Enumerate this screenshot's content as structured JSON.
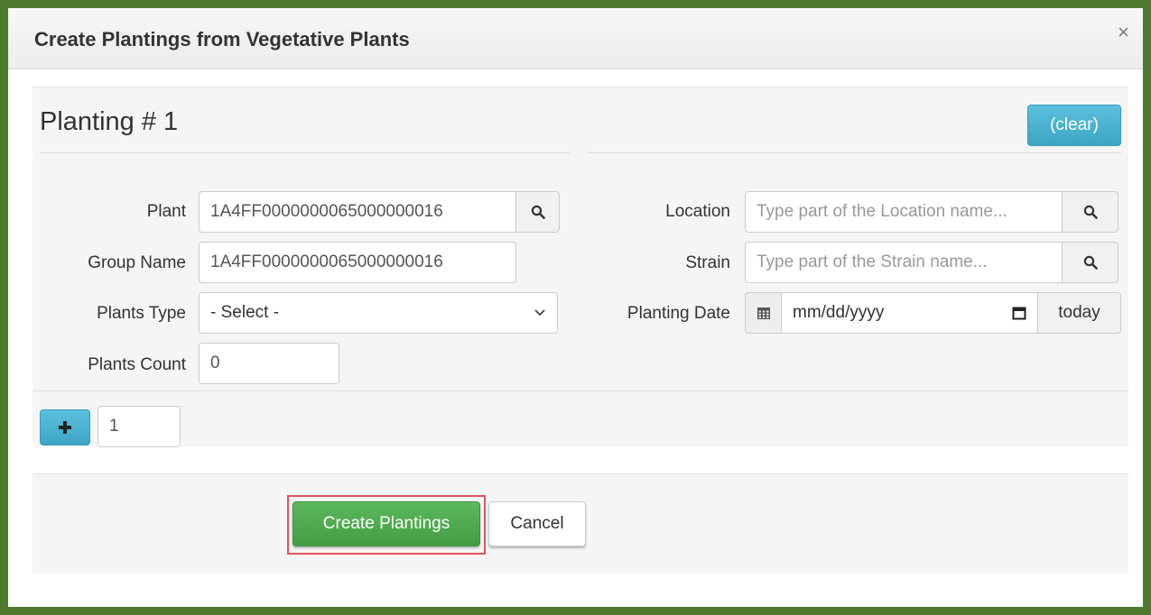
{
  "modal": {
    "title": "Create Plantings from Vegetative Plants",
    "close_label": "×"
  },
  "planting": {
    "heading": "Planting # 1",
    "clear_label": "(clear)"
  },
  "form": {
    "plant": {
      "label": "Plant",
      "value": "1A4FF0000000065000000016"
    },
    "group_name": {
      "label": "Group Name",
      "value": "1A4FF0000000065000000016"
    },
    "plants_type": {
      "label": "Plants Type",
      "selected": "- Select -"
    },
    "plants_count": {
      "label": "Plants Count",
      "value": "0"
    },
    "location": {
      "label": "Location",
      "placeholder": "Type part of the Location name..."
    },
    "strain": {
      "label": "Strain",
      "placeholder": "Type part of the Strain name..."
    },
    "planting_date": {
      "label": "Planting Date",
      "placeholder": "mm/dd/yyyy",
      "today_label": "today"
    }
  },
  "add_row": {
    "count": "1"
  },
  "actions": {
    "create_label": "Create Plantings",
    "cancel_label": "Cancel"
  },
  "icons": {
    "search": "search-icon",
    "calendar": "calendar-icon",
    "plus": "plus-icon",
    "chevron": "chevron-down-icon"
  },
  "colors": {
    "frame": "#4e7a2e",
    "primary_info": "#5bc0de",
    "success": "#5cb85c",
    "highlight": "#e0525b"
  }
}
